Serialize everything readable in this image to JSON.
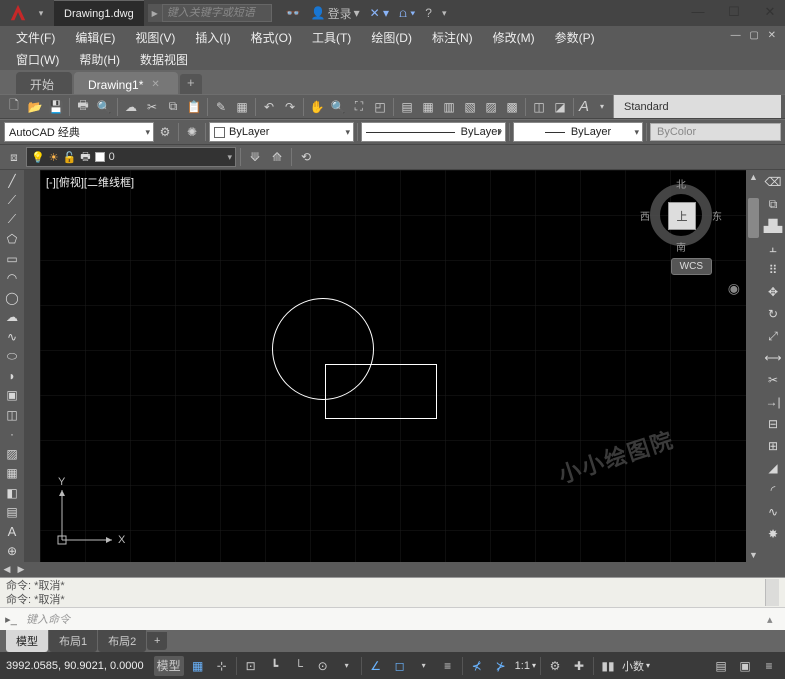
{
  "titlebar": {
    "doc": "Drawing1.dwg",
    "search_placeholder": "键入关键字或短语",
    "login": "登录",
    "help": "?"
  },
  "menu": {
    "row1": [
      "文件(F)",
      "编辑(E)",
      "视图(V)",
      "插入(I)",
      "格式(O)",
      "工具(T)",
      "绘图(D)",
      "标注(N)",
      "修改(M)",
      "参数(P)"
    ],
    "row2": [
      "窗口(W)",
      "帮助(H)",
      "数据视图"
    ]
  },
  "filetabs": {
    "inactive": "开始",
    "active": "Drawing1*"
  },
  "toolbar2": {
    "workspace": "AutoCAD 经典",
    "layer_color": "ByLayer",
    "linetype": "ByLayer",
    "lineweight": "ByLayer",
    "bycolor": "ByColor",
    "style": "Standard"
  },
  "layer": {
    "name": "0"
  },
  "canvas": {
    "view_label": "[-][俯视][二维线框]",
    "axis_x": "X",
    "axis_y": "Y",
    "watermark": "小小绘图院",
    "cube_face": "上",
    "dir_n": "北",
    "dir_s": "南",
    "dir_e": "东",
    "dir_w": "西",
    "wcs": "WCS"
  },
  "command": {
    "line1": "命令: *取消*",
    "line2": "命令: *取消*",
    "prompt": "键入命令"
  },
  "layout": {
    "model": "模型",
    "l1": "布局1",
    "l2": "布局2"
  },
  "status": {
    "coords": "3992.0585, 90.9021, 0.0000",
    "model": "模型",
    "ratio": "1:1",
    "precision": "小数"
  }
}
